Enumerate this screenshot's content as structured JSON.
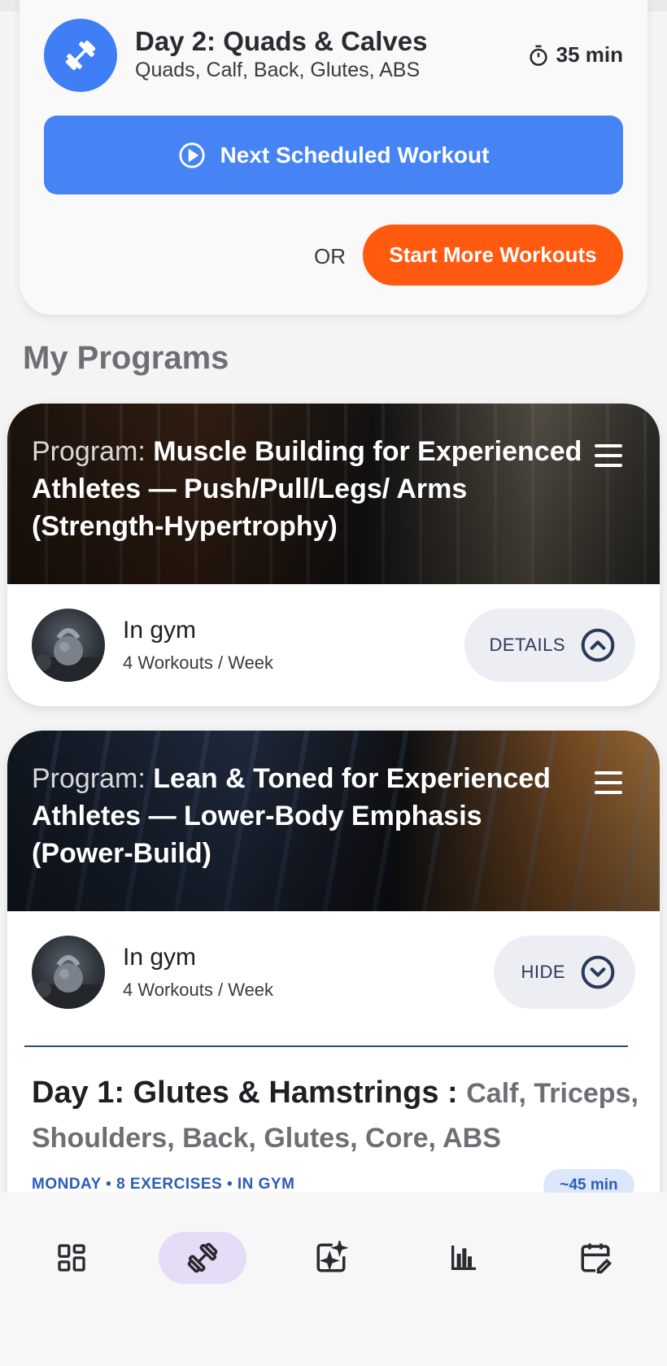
{
  "workout": {
    "title": "Day 2: Quads & Calves",
    "muscles": "Quads, Calf, Back, Glutes, ABS",
    "duration": "35 min",
    "next_button": "Next Scheduled Workout",
    "or_label": "OR",
    "more_button": "Start More Workouts"
  },
  "section_title": "My Programs",
  "programs": [
    {
      "prefix": "Program: ",
      "name": "Muscle Building for Experienced Athletes — Push/Pull/Legs/ Arms (Strength-Hypertrophy)",
      "location": "In gym",
      "frequency": "4 Workouts / Week",
      "toggle_label": "DETAILS"
    },
    {
      "prefix": "Program: ",
      "name": "Lean & Toned for Experienced Athletes — Lower-Body Emphasis (Power-Build)",
      "location": "In gym",
      "frequency": "4 Workouts / Week",
      "toggle_label": "HIDE",
      "day": {
        "title": "Day 1: Glutes & Hamstrings :",
        "muscles": "Calf, Triceps, Shoulders, Back, Glutes, Core, ABS",
        "meta": "MONDAY • 8 EXERCISES • IN GYM",
        "duration": "~45 min"
      }
    }
  ],
  "nav": [
    "dashboard-icon",
    "dumbbell-icon",
    "ai-sparkle-icon",
    "stats-chart-icon",
    "calendar-edit-icon"
  ],
  "colors": {
    "primary_blue": "#4684f6",
    "accent_orange": "#ff5a0f",
    "nav_active": "#e6dcf8",
    "link_blue": "#2c5cb8"
  }
}
